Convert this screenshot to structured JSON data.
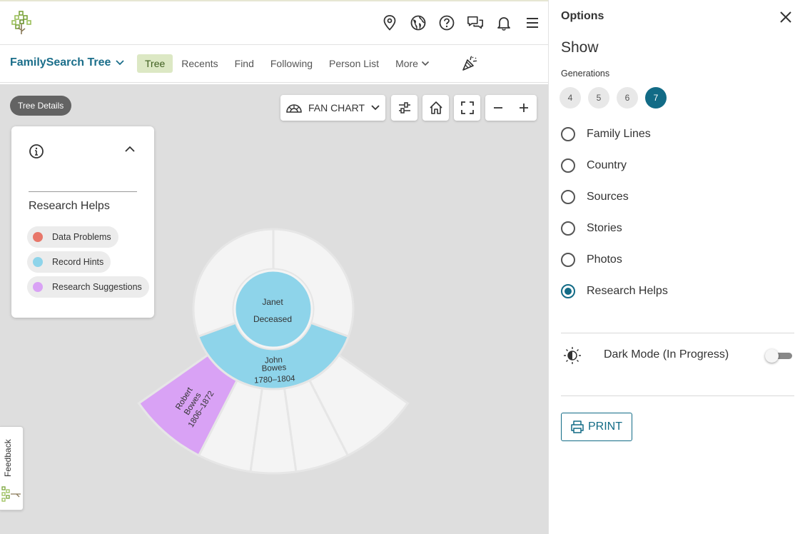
{
  "app": {
    "tree_title": "FamilySearch Tree",
    "tabs": [
      {
        "label": "Tree",
        "active": true
      },
      {
        "label": "Recents"
      },
      {
        "label": "Find"
      },
      {
        "label": "Following"
      },
      {
        "label": "Person List"
      },
      {
        "label": "More"
      }
    ],
    "top_icons": [
      "map-pin-icon",
      "globe-icon",
      "help-icon",
      "chat-icon",
      "bell-icon",
      "menu-icon"
    ]
  },
  "canvas": {
    "tree_details_label": "Tree Details",
    "chart_type_label": "FAN CHART",
    "legend": {
      "title": "Research Helps",
      "items": [
        {
          "label": "Data Problems",
          "color": "#e8776a"
        },
        {
          "label": "Record Hints",
          "color": "#8ed4ea"
        },
        {
          "label": "Research Suggestions",
          "color": "#d9a2f5"
        }
      ]
    },
    "fan": {
      "center": {
        "name": "Janet",
        "status": "Deceased",
        "color": "#8ed4ea"
      },
      "parent": {
        "given": "John",
        "surname": "Bowes",
        "dates": "1780–1804",
        "color": "#8ed4ea"
      },
      "grandparent": {
        "given": "Robert",
        "surname": "Bowes",
        "dates": "1806–1872",
        "color": "#d9a2f5"
      },
      "empty_color": "#f4f4f4"
    },
    "feedback_label": "Feedback"
  },
  "options": {
    "title": "Options",
    "show_heading": "Show",
    "generations_label": "Generations",
    "generations": [
      "4",
      "5",
      "6",
      "7"
    ],
    "selected_generation": "7",
    "show_options": [
      {
        "label": "Family Lines",
        "checked": false
      },
      {
        "label": "Country",
        "checked": false
      },
      {
        "label": "Sources",
        "checked": false
      },
      {
        "label": "Stories",
        "checked": false
      },
      {
        "label": "Photos",
        "checked": false
      },
      {
        "label": "Research Helps",
        "checked": true
      }
    ],
    "dark_mode_label": "Dark Mode (In Progress)",
    "dark_mode_on": false,
    "print_label": "PRINT",
    "accent": "#126b86"
  }
}
